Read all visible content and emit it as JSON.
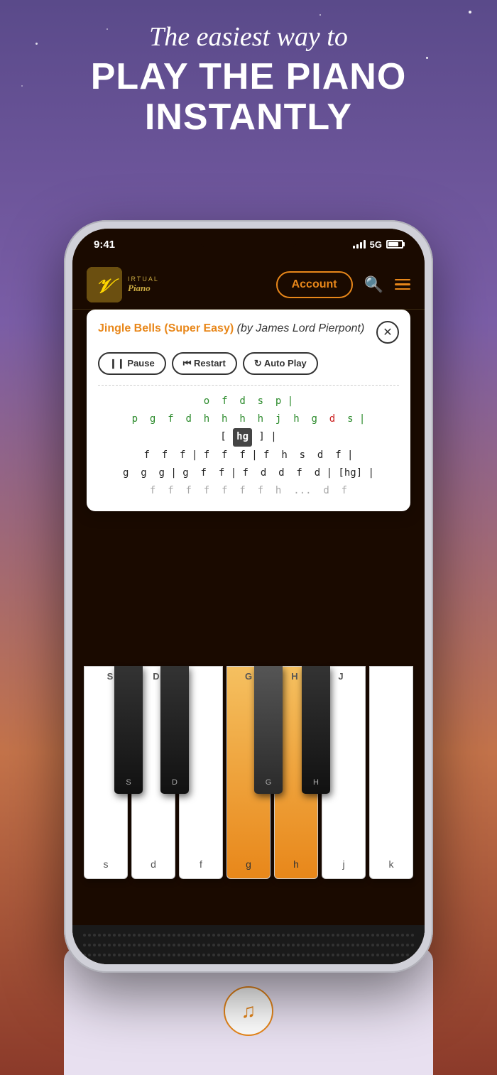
{
  "hero": {
    "tagline": "The easiest way to",
    "line1": "PLAY THE PIANO",
    "line2": "INSTANTLY"
  },
  "status_bar": {
    "time": "9:41",
    "signal": "5G"
  },
  "header": {
    "logo_v": "V",
    "logo_virtual": "IRTUAL",
    "logo_piano": "Piano",
    "account_label": "Account"
  },
  "song": {
    "title_colored": "Jingle Bells (Super Easy)",
    "title_rest": " (by James Lord Pierpont)"
  },
  "controls": {
    "pause": "❙❙ Pause",
    "restart": "⏮ Restart",
    "autoplay": "↻ Auto Play"
  },
  "notes": {
    "line1_green": "o  f  d  s  p |",
    "line2_green": "p  g  f  d  h  h  h  h  j  h  g",
    "line2_red": "d",
    "line2_end": "s |",
    "line3": "[ hg ] |",
    "line4": "f  f  f | f  f  f | f  h  s  d  f |",
    "line5": "g  g  g | g  f  f | f  d  d  f  d | [ hg ] |",
    "line6_partial": "f  f  f  f  f  f  f  h ..."
  },
  "piano_keys": {
    "white": [
      "s",
      "d",
      "f",
      "g",
      "h",
      "j",
      "k"
    ],
    "white_upper": [
      "S",
      "D",
      "",
      "G",
      "H",
      "J",
      ""
    ],
    "black": [
      "S",
      "D",
      "",
      "G",
      "H"
    ],
    "active_keys": [
      "g",
      "h"
    ]
  },
  "bottom": {
    "music_note": "♫"
  },
  "colors": {
    "orange": "#E8871A",
    "dark_bg": "#1a0a00",
    "green_note": "#2a8a2a",
    "red_note": "#cc2222",
    "highlight_bg": "#444444"
  }
}
